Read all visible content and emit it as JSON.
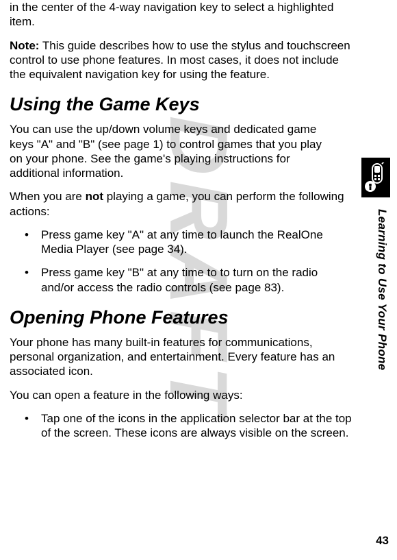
{
  "watermark": "DRAFT",
  "side_tab_label": "Learning to Use Your Phone",
  "page_number": "43",
  "paras": {
    "intro_cont": "in the center of the 4-way navigation key to select a highlighted item.",
    "note_prefix": "Note:",
    "note_body": " This guide describes how to use the stylus and touchscreen control to use phone features. In most cases, it does not include the equivalent navigation key for using the feature.",
    "h_game_keys": "Using the Game Keys",
    "game_keys_p1": "You can use the up/down volume keys and dedicated game keys \"A\" and \"B\" (see page 1) to control games that you play on your phone. See the game's playing instructions for additional information.",
    "game_keys_p2a": "When you are ",
    "game_keys_p2b_bold": "not",
    "game_keys_p2c": " playing a game, you can perform the following actions:",
    "bullet_a": "Press game key \"A\" at any time to launch the RealOne Media Player (see page 34).",
    "bullet_b": "Press game key \"B\" at any time to to turn on the radio and/or access the radio controls (see page 83).",
    "h_opening": "Opening Phone Features",
    "opening_p1": "Your phone has many built-in features for communications, personal organization, and entertainment. Every feature has an associated icon.",
    "opening_p2": "You can open a feature in the following ways:",
    "bullet_open1": "Tap one of the icons in the application selector bar at the top of the screen. These icons are always visible on the screen."
  }
}
